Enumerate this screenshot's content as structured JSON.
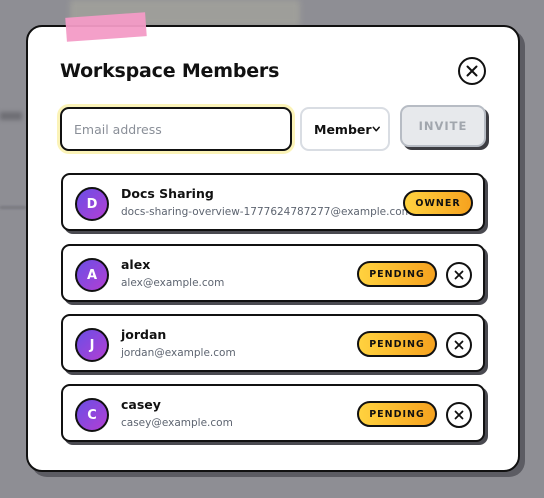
{
  "modal": {
    "title": "Workspace Members"
  },
  "invite_form": {
    "email_placeholder": "Email address",
    "email_value": "",
    "role_selected": "Member",
    "invite_label": "INVITE"
  },
  "members": [
    {
      "initial": "D",
      "name": "Docs Sharing",
      "email": "docs-sharing-overview-1777624787277@example.com",
      "badge": "OWNER",
      "removable": false
    },
    {
      "initial": "A",
      "name": "alex",
      "email": "alex@example.com",
      "badge": "PENDING",
      "removable": true
    },
    {
      "initial": "J",
      "name": "jordan",
      "email": "jordan@example.com",
      "badge": "PENDING",
      "removable": true
    },
    {
      "initial": "C",
      "name": "casey",
      "email": "casey@example.com",
      "badge": "PENDING",
      "removable": true
    }
  ],
  "icons": {
    "close": "close-icon",
    "dropdown": "chevron-down-icon",
    "remove": "close-icon"
  },
  "colors": {
    "avatar_gradient_start": "#6a4ee6",
    "avatar_gradient_end": "#b33fd3",
    "badge_start": "#ffd23f",
    "badge_end": "#f6a21f",
    "accent_tape": "#f39bc6"
  }
}
